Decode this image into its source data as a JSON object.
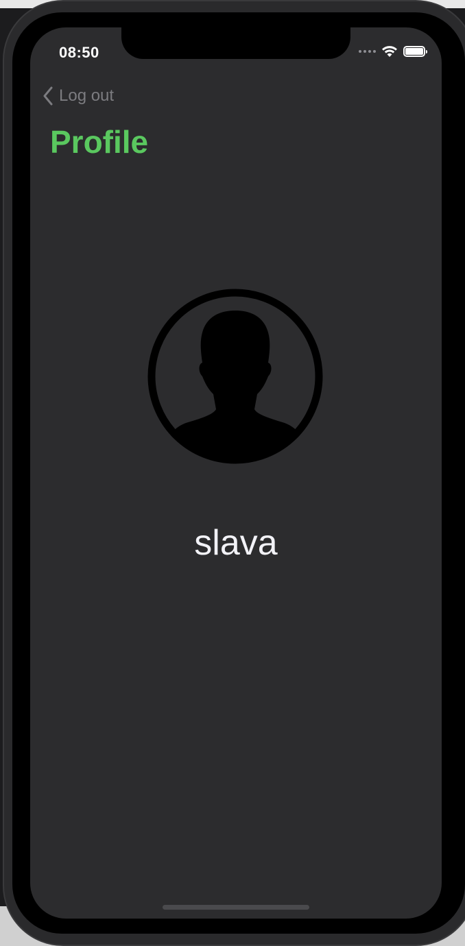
{
  "status_bar": {
    "time": "08:50"
  },
  "nav": {
    "back_label": "Log out"
  },
  "header": {
    "title": "Profile"
  },
  "profile": {
    "username": "slava"
  },
  "icons": {
    "back": "chevron-left-icon",
    "avatar": "person-circle-icon",
    "wifi": "wifi-icon",
    "battery": "battery-icon",
    "signal": "signal-icon"
  },
  "colors": {
    "accent": "#5ac85f",
    "background": "#2c2c2e",
    "text_primary": "#f2f2f7",
    "text_secondary": "#7c7c80"
  }
}
